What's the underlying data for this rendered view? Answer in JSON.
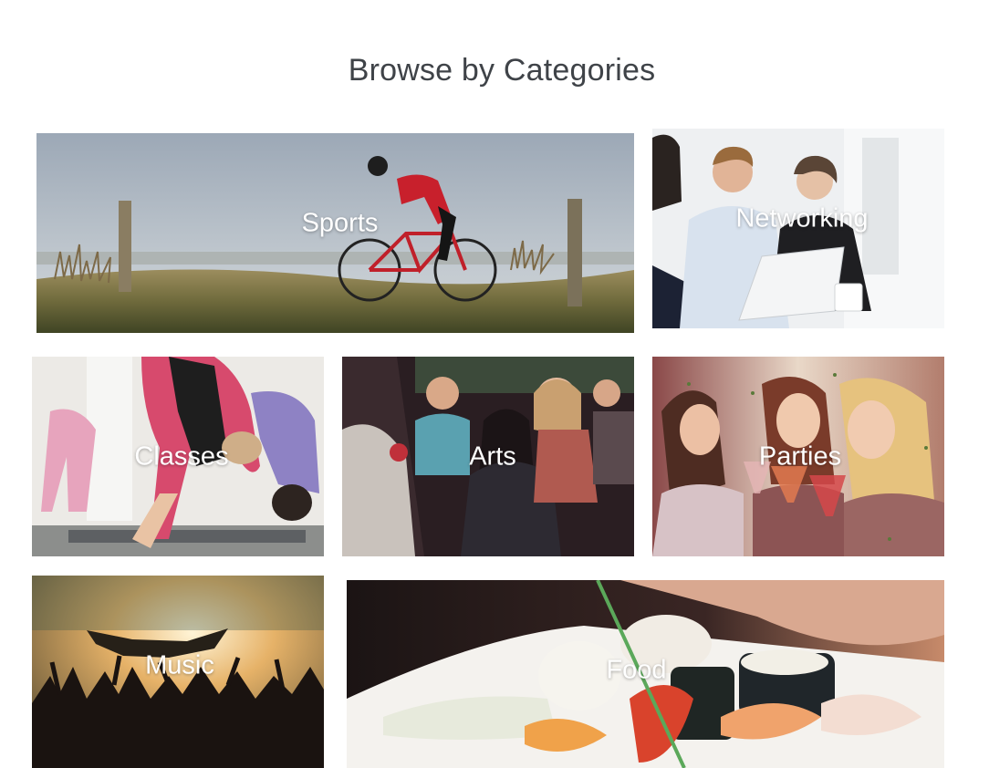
{
  "header": {
    "title": "Browse by Categories"
  },
  "categories": [
    {
      "id": "sports",
      "label": "Sports",
      "image": "cyclist-on-country-road"
    },
    {
      "id": "networking",
      "label": "Networking",
      "image": "business-meeting-laptop"
    },
    {
      "id": "classes",
      "label": "Classes",
      "image": "yoga-class"
    },
    {
      "id": "arts",
      "label": "Arts",
      "image": "theater-audience"
    },
    {
      "id": "parties",
      "label": "Parties",
      "image": "women-toasting-cocktails"
    },
    {
      "id": "music",
      "label": "Music",
      "image": "concert-crowd-surfing"
    },
    {
      "id": "food",
      "label": "Food",
      "image": "sushi-platter"
    }
  ]
}
